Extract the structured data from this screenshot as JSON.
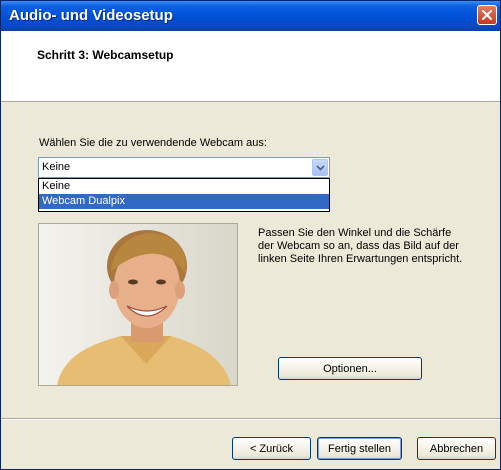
{
  "window": {
    "title": "Audio- und Videosetup"
  },
  "header": {
    "step_title": "Schritt 3: Webcamsetup"
  },
  "webcam": {
    "prompt": "Wählen Sie die zu verwendende Webcam aus:",
    "selected_value": "Keine",
    "options": [
      "Keine",
      "Webcam Dualpix"
    ],
    "highlighted_option": "Webcam Dualpix"
  },
  "instructions": "Passen Sie den Winkel und die Schärfe der Webcam so an, dass das Bild auf der linken Seite Ihren Erwartungen entspricht.",
  "buttons": {
    "options": "Optionen...",
    "back": "< Zurück",
    "finish": "Fertig stellen",
    "cancel": "Abbrechen"
  },
  "icons": {
    "close": "close-icon",
    "dropdown": "chevron-down-icon"
  },
  "colors": {
    "titlebar": "#0050d8",
    "dialog_bg": "#ece9d8",
    "selection": "#316ac5",
    "close_button": "#c5381f"
  }
}
